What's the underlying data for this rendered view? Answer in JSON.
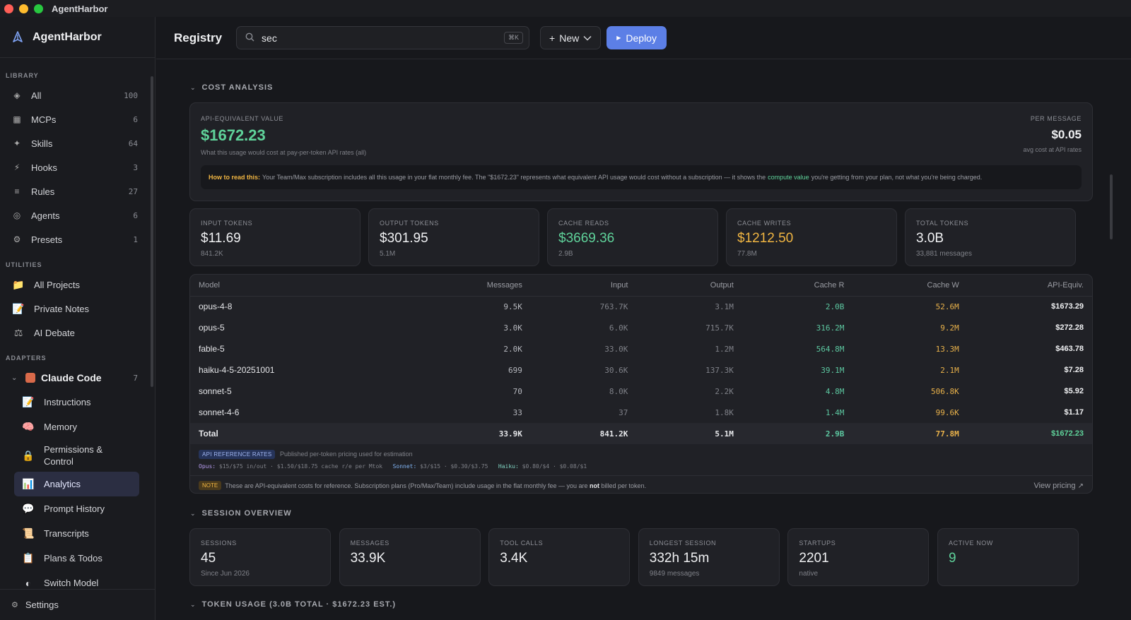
{
  "window": {
    "title": "AgentHarbor"
  },
  "sidebar": {
    "brand": "AgentHarbor",
    "library_label": "LIBRARY",
    "library": [
      {
        "icon": "diamond-icon",
        "label": "All",
        "count": "100"
      },
      {
        "icon": "server-icon",
        "label": "MCPs",
        "count": "6"
      },
      {
        "icon": "sparkle-icon",
        "label": "Skills",
        "count": "64"
      },
      {
        "icon": "lightning-icon",
        "label": "Hooks",
        "count": "3"
      },
      {
        "icon": "list-icon",
        "label": "Rules",
        "count": "27"
      },
      {
        "icon": "agent-icon",
        "label": "Agents",
        "count": "6"
      },
      {
        "icon": "gear-icon",
        "label": "Presets",
        "count": "1"
      }
    ],
    "utilities_label": "UTILITIES",
    "utilities": [
      {
        "icon": "folder-icon",
        "label": "All Projects"
      },
      {
        "icon": "notes-icon",
        "label": "Private Notes"
      },
      {
        "icon": "scales-icon",
        "label": "AI Debate"
      }
    ],
    "adapters_label": "ADAPTERS",
    "adapter": {
      "label": "Claude Code",
      "count": "7"
    },
    "adapter_items": [
      {
        "icon": "pencil-icon",
        "label": "Instructions"
      },
      {
        "icon": "brain-icon",
        "label": "Memory"
      },
      {
        "icon": "lock-icon",
        "label": "Permissions &",
        "label2": "Control"
      },
      {
        "icon": "chart-icon",
        "label": "Analytics",
        "active": true
      },
      {
        "icon": "speech-icon",
        "label": "Prompt History"
      },
      {
        "icon": "scroll-icon",
        "label": "Transcripts"
      },
      {
        "icon": "clipboard-icon",
        "label": "Plans & Todos"
      },
      {
        "icon": "switch-icon",
        "label": "Switch Model"
      }
    ],
    "settings": "Settings"
  },
  "header": {
    "title": "Registry",
    "search_value": "sec",
    "search_shortcut": "⌘K",
    "new_label": "New",
    "deploy_label": "Deploy"
  },
  "cost": {
    "section_title": "COST ANALYSIS",
    "api_label": "API-EQUIVALENT VALUE",
    "api_value": "$1672.23",
    "api_sub": "What this usage would cost at pay-per-token API rates (all)",
    "per_label": "PER MESSAGE",
    "per_value": "$0.05",
    "per_sub": "avg cost at API rates",
    "howto_label": "How to read this:",
    "howto_text1": "Your Team/Max subscription includes all this usage in your flat monthly fee. The \"$1672.23\" represents what equivalent API usage would cost without a subscription — it shows the",
    "howto_hl": "compute value",
    "howto_text2": "you're getting from your plan, not what you're being charged."
  },
  "token_cards": [
    {
      "label": "INPUT TOKENS",
      "value": "$11.69",
      "sub": "841.2K",
      "color": "white"
    },
    {
      "label": "OUTPUT TOKENS",
      "value": "$301.95",
      "sub": "5.1M",
      "color": "white"
    },
    {
      "label": "CACHE READS",
      "value": "$3669.36",
      "sub": "2.9B",
      "color": "green"
    },
    {
      "label": "CACHE WRITES",
      "value": "$1212.50",
      "sub": "77.8M",
      "color": "amber"
    },
    {
      "label": "TOTAL TOKENS",
      "value": "3.0B",
      "sub": "33,881 messages",
      "color": "white"
    }
  ],
  "table": {
    "headers": [
      "Model",
      "Messages",
      "Input",
      "Output",
      "Cache R",
      "Cache W",
      "API-Equiv."
    ],
    "rows": [
      [
        "opus-4-8",
        "9.5K",
        "763.7K",
        "3.1M",
        "2.0B",
        "52.6M",
        "$1673.29"
      ],
      [
        "opus-5",
        "3.0K",
        "6.0K",
        "715.7K",
        "316.2M",
        "9.2M",
        "$272.28"
      ],
      [
        "fable-5",
        "2.0K",
        "33.0K",
        "1.2M",
        "564.8M",
        "13.3M",
        "$463.78"
      ],
      [
        "haiku-4-5-20251001",
        "699",
        "30.6K",
        "137.3K",
        "39.1M",
        "2.1M",
        "$7.28"
      ],
      [
        "sonnet-5",
        "70",
        "8.0K",
        "2.2K",
        "4.8M",
        "506.8K",
        "$5.92"
      ],
      [
        "sonnet-4-6",
        "33",
        "37",
        "1.8K",
        "1.4M",
        "99.6K",
        "$1.17"
      ]
    ],
    "total": [
      "Total",
      "33.9K",
      "841.2K",
      "5.1M",
      "2.9B",
      "77.8M",
      "$1672.23"
    ]
  },
  "rates": {
    "badge": "API REFERENCE RATES",
    "desc": "Published per-token pricing used for estimation",
    "opus_label": "Opus:",
    "opus": "$15/$75 in/out · $1.50/$18.75 cache r/e per Mtok",
    "sonnet_label": "Sonnet:",
    "sonnet": "$3/$15 · $0.30/$3.75",
    "haiku_label": "Haiku:",
    "haiku": "$0.80/$4 · $0.08/$1"
  },
  "note": {
    "badge": "NOTE",
    "text1": "These are API-equivalent costs for reference. Subscription plans (Pro/Max/Team) include usage in the flat monthly fee — you are",
    "bold": "not",
    "text2": "billed per token.",
    "link": "View pricing"
  },
  "session": {
    "section_title": "SESSION OVERVIEW",
    "cards": [
      {
        "label": "SESSIONS",
        "value": "45",
        "sub": "Since Jun 2026",
        "color": "white"
      },
      {
        "label": "MESSAGES",
        "value": "33.9K",
        "sub": "",
        "color": "white"
      },
      {
        "label": "TOOL CALLS",
        "value": "3.4K",
        "sub": "",
        "color": "white"
      },
      {
        "label": "LONGEST SESSION",
        "value": "332h 15m",
        "sub": "9849 messages",
        "color": "white"
      },
      {
        "label": "STARTUPS",
        "value": "2201",
        "sub": "native",
        "color": "white"
      },
      {
        "label": "ACTIVE NOW",
        "value": "9",
        "sub": "",
        "color": "green"
      }
    ]
  },
  "token_usage": {
    "section_title": "TOKEN USAGE (3.0B TOTAL · $1672.23 EST.)"
  }
}
